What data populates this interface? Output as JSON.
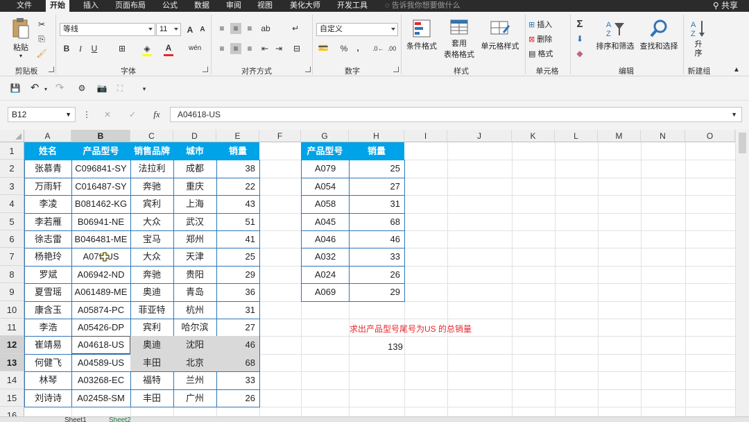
{
  "ribbon_tabs": [
    "文件",
    "开始",
    "插入",
    "页面布局",
    "公式",
    "数据",
    "审阅",
    "视图",
    "美化大师",
    "开发工具"
  ],
  "active_tab": "开始",
  "tell_me": "告诉我你想要做什么",
  "share": "共享",
  "clipboard": {
    "paste": "粘贴",
    "label": "剪贴板"
  },
  "font": {
    "name": "等线",
    "size": "11",
    "bold": "B",
    "italic": "I",
    "underline": "U",
    "grow": "A",
    "shrink": "A",
    "color_a": "A",
    "label": "字体"
  },
  "alignment": {
    "label": "对齐方式"
  },
  "number": {
    "format": "自定义",
    "percent": "%",
    "comma": ",",
    "label": "数字"
  },
  "styles": {
    "conditional": "条件格式",
    "table_top": "套用",
    "table_bottom": "表格格式",
    "cell_styles": "单元格样式",
    "label": "样式"
  },
  "cells": {
    "insert": "插入",
    "delete": "删除",
    "format": "格式",
    "label": "单元格"
  },
  "editing": {
    "sigma": "Σ",
    "sort": "排序和筛选",
    "find": "查找和选择",
    "label": "编辑"
  },
  "new_group": {
    "sort_asc": "升序",
    "label": "新建组"
  },
  "name_box": "B12",
  "formula_bar": {
    "cancel": "✕",
    "enter": "✓",
    "fx": "fx",
    "content": "A04618-US"
  },
  "columns": [
    "A",
    "B",
    "C",
    "D",
    "E",
    "F",
    "G",
    "H",
    "I",
    "J",
    "K",
    "L",
    "M",
    "N",
    "O"
  ],
  "rows": [
    "1",
    "2",
    "3",
    "4",
    "5",
    "6",
    "7",
    "8",
    "9",
    "10",
    "11",
    "12",
    "13",
    "14",
    "15",
    "16"
  ],
  "table1": {
    "headers": [
      "姓名",
      "产品型号",
      "销售品牌",
      "城市",
      "销量"
    ],
    "rows": [
      [
        "张慕青",
        "C096841-SY",
        "法拉利",
        "成都",
        "38"
      ],
      [
        "万雨轩",
        "C016487-SY",
        "奔驰",
        "重庆",
        "22"
      ],
      [
        "李凌",
        "B081462-KG",
        "宾利",
        "上海",
        "43"
      ],
      [
        "李若雁",
        "B06941-NE",
        "大众",
        "武汉",
        "51"
      ],
      [
        "徐志雷",
        "B046481-ME",
        "宝马",
        "郑州",
        "41"
      ],
      [
        "杨艳玲",
        "A079  US",
        "大众",
        "天津",
        "25"
      ],
      [
        "罗斌",
        "A06942-ND",
        "奔驰",
        "贵阳",
        "29"
      ],
      [
        "夏雪瑶",
        "A061489-ME",
        "奥迪",
        "青岛",
        "36"
      ],
      [
        "康含玉",
        "A05874-PC",
        "菲亚特",
        "杭州",
        "31"
      ],
      [
        "李浩",
        "A05426-DP",
        "宾利",
        "哈尔滨",
        "27"
      ],
      [
        "崔靖易",
        "A04618-US",
        "奥迪",
        "沈阳",
        "46"
      ],
      [
        "何健飞",
        "A04589-US",
        "丰田",
        "北京",
        "68"
      ],
      [
        "林琴",
        "A03268-EC",
        "福特",
        "兰州",
        "33"
      ],
      [
        "刘诗诗",
        "A02458-SM",
        "丰田",
        "广州",
        "26"
      ]
    ]
  },
  "table2": {
    "headers": [
      "产品型号",
      "销量"
    ],
    "rows": [
      [
        "A079",
        "25"
      ],
      [
        "A054",
        "27"
      ],
      [
        "A058",
        "31"
      ],
      [
        "A045",
        "68"
      ],
      [
        "A046",
        "46"
      ],
      [
        "A032",
        "33"
      ],
      [
        "A024",
        "26"
      ],
      [
        "A069",
        "29"
      ]
    ]
  },
  "note": "求出产品型号尾号为US 的总销量",
  "result": "139",
  "sheets": [
    "Sheet1",
    "Sheet2"
  ],
  "colors": {
    "header_fill": "#00a2e8",
    "border_blue": "#2e75b6",
    "note_red": "#e8262b",
    "selected_fill": "#d9d9d9"
  }
}
